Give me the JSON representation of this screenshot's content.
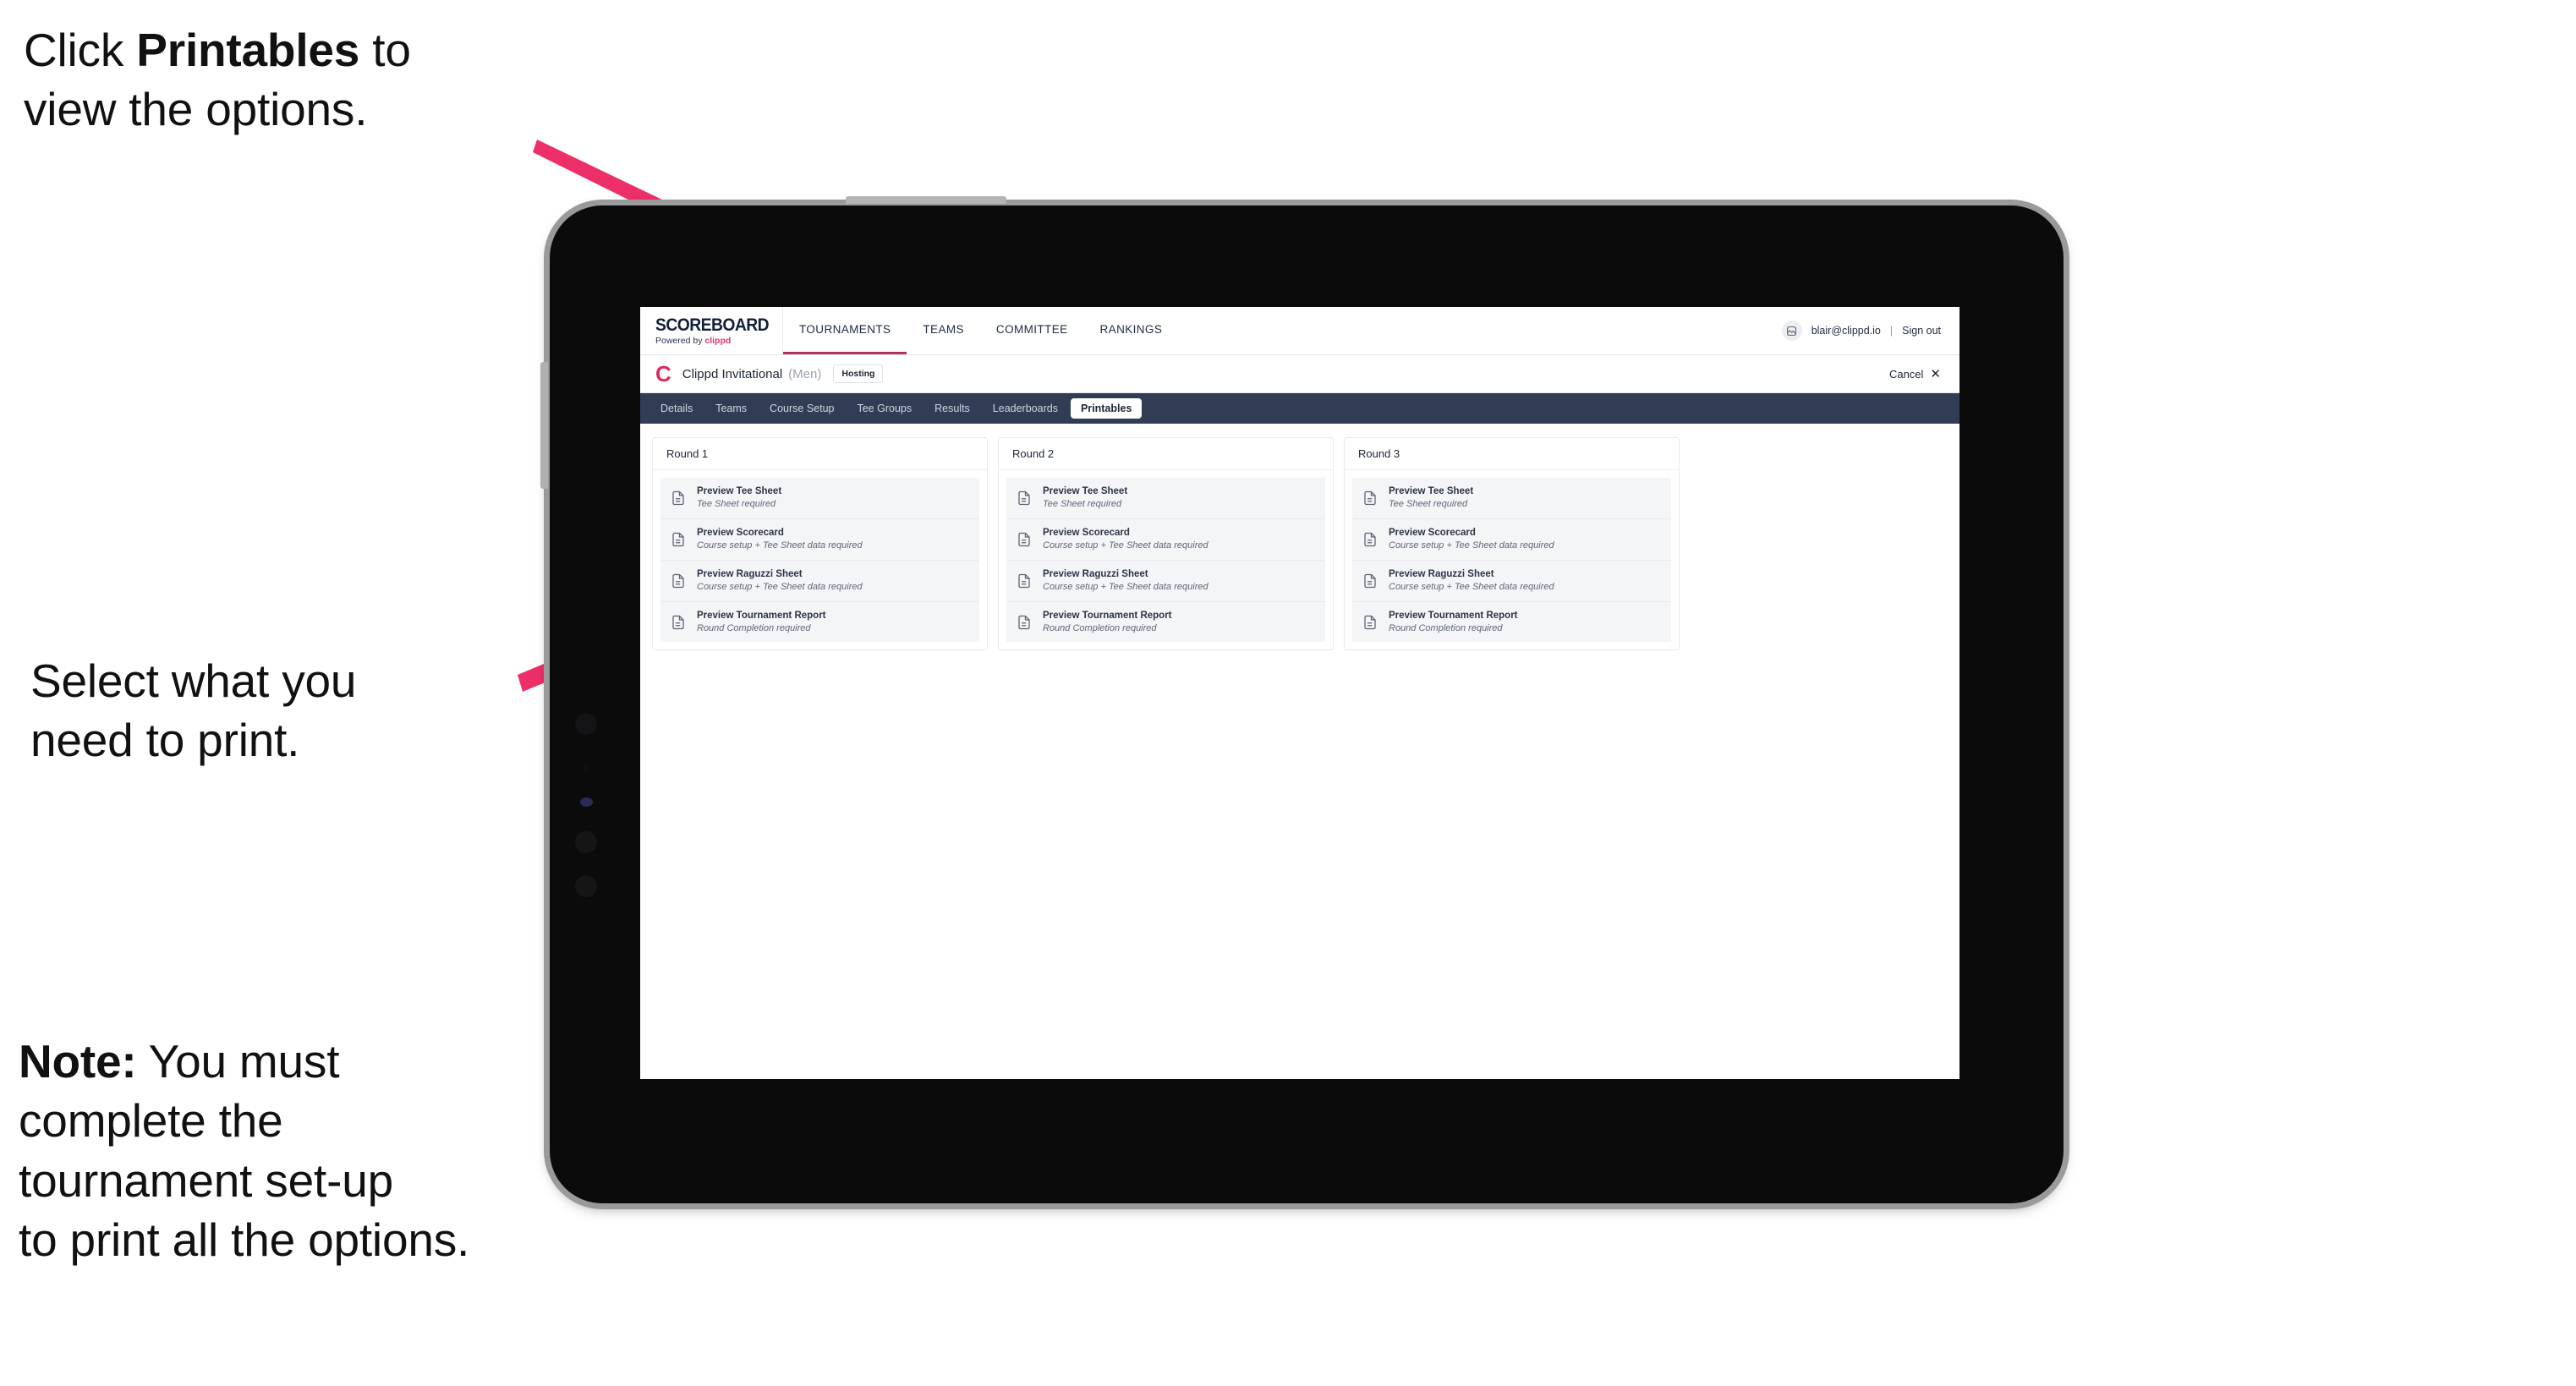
{
  "annotations": {
    "click_printables": "Click **Printables** to\nview the options.",
    "click_printables_plain_1": "Click ",
    "click_printables_bold": "Printables",
    "click_printables_plain_2": " to\nview the options.",
    "select_print": "Select what you\n need to print.",
    "note_bold": "Note:",
    "note_rest": " You must\ncomplete the\ntournament set-up\nto print all the options."
  },
  "colors": {
    "arrow_pink": "#ed2f68",
    "brand_accent": "#e8336d",
    "tab_bar_bg": "#303d55",
    "active_tab_underline": "#b0325c",
    "card_bg": "#f4f5f7"
  },
  "app": {
    "brand": {
      "title": "SCOREBOARD",
      "powered_prefix": "Powered by ",
      "powered_name": "clippd"
    },
    "topnav": [
      {
        "label": "TOURNAMENTS",
        "active": true
      },
      {
        "label": "TEAMS",
        "active": false
      },
      {
        "label": "COMMITTEE",
        "active": false
      },
      {
        "label": "RANKINGS",
        "active": false
      }
    ],
    "account": {
      "avatar_icon": "user-avatar-icon",
      "email": "blair@clippd.io",
      "separator": "|",
      "sign_out": "Sign out"
    },
    "tournament_bar": {
      "logo_letter": "C",
      "name": "Clippd Invitational",
      "gender": "(Men)",
      "badge": "Hosting",
      "cancel_label": "Cancel",
      "cancel_icon": "close-icon"
    },
    "section_tabs": [
      {
        "label": "Details",
        "active": false
      },
      {
        "label": "Teams",
        "active": false
      },
      {
        "label": "Course Setup",
        "active": false
      },
      {
        "label": "Tee Groups",
        "active": false
      },
      {
        "label": "Results",
        "active": false
      },
      {
        "label": "Leaderboards",
        "active": false
      },
      {
        "label": "Printables",
        "active": true
      }
    ],
    "rounds": [
      {
        "title": "Round 1",
        "items": [
          {
            "title": "Preview Tee Sheet",
            "subtitle": "Tee Sheet required"
          },
          {
            "title": "Preview Scorecard",
            "subtitle": "Course setup + Tee Sheet data required"
          },
          {
            "title": "Preview Raguzzi Sheet",
            "subtitle": "Course setup + Tee Sheet data required"
          },
          {
            "title": "Preview Tournament Report",
            "subtitle": "Round Completion required"
          }
        ]
      },
      {
        "title": "Round 2",
        "items": [
          {
            "title": "Preview Tee Sheet",
            "subtitle": "Tee Sheet required"
          },
          {
            "title": "Preview Scorecard",
            "subtitle": "Course setup + Tee Sheet data required"
          },
          {
            "title": "Preview Raguzzi Sheet",
            "subtitle": "Course setup + Tee Sheet data required"
          },
          {
            "title": "Preview Tournament Report",
            "subtitle": "Round Completion required"
          }
        ]
      },
      {
        "title": "Round 3",
        "items": [
          {
            "title": "Preview Tee Sheet",
            "subtitle": "Tee Sheet required"
          },
          {
            "title": "Preview Scorecard",
            "subtitle": "Course setup + Tee Sheet data required"
          },
          {
            "title": "Preview Raguzzi Sheet",
            "subtitle": "Course setup + Tee Sheet data required"
          },
          {
            "title": "Preview Tournament Report",
            "subtitle": "Round Completion required"
          }
        ]
      }
    ]
  }
}
